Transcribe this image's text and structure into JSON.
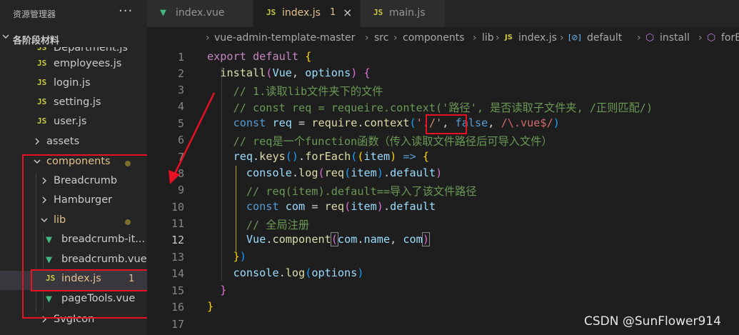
{
  "sidebar": {
    "title": "资源管理器",
    "more_icon": "ellipsis-icon",
    "section_label": "各阶段材料",
    "items": [
      {
        "label": "Department.js",
        "type": "js"
      },
      {
        "label": "employees.js",
        "type": "js"
      },
      {
        "label": "login.js",
        "type": "js"
      },
      {
        "label": "setting.js",
        "type": "js"
      },
      {
        "label": "user.js",
        "type": "js"
      },
      {
        "label": "assets",
        "type": "folder-collapsed"
      },
      {
        "label": "components",
        "type": "folder-expanded"
      },
      {
        "label": "Breadcrumb",
        "type": "folder-collapsed"
      },
      {
        "label": "Hamburger",
        "type": "folder-collapsed"
      },
      {
        "label": "lib",
        "type": "folder-expanded"
      },
      {
        "label": "breadcrumb-it...",
        "type": "vue"
      },
      {
        "label": "breadcrumb.vue",
        "type": "vue"
      },
      {
        "label": "index.js",
        "type": "js",
        "badge": "1"
      },
      {
        "label": "pageTools.vue",
        "type": "vue"
      },
      {
        "label": "SvgIcon",
        "type": "folder-collapsed"
      }
    ]
  },
  "tabs": [
    {
      "label": "index.vue",
      "type": "vue"
    },
    {
      "label": "index.js",
      "type": "js",
      "badge": "1",
      "active": true
    },
    {
      "label": "main.js",
      "type": "js"
    }
  ],
  "file_icon_text": "JS",
  "breadcrumb": [
    "vue-admin-template-master",
    "src",
    "components",
    "lib",
    "index.js",
    "default",
    "install",
    "forEach"
  ],
  "code": {
    "line_numbers": [
      "1",
      "2",
      "3",
      "4",
      "5",
      "6",
      "7",
      "8",
      "9",
      "10",
      "11",
      "12",
      "13",
      "14",
      "15",
      "16",
      "17"
    ],
    "current_line": "12",
    "comment1": "// 1.读取lib文件夹下的文件",
    "comment2": "// const req = requeire.context('路径', 是否读取子文件夹, /正则匹配/)",
    "comment3": "// req是一个function函数（传入读取文件路径后可导入文件）",
    "comment4": "// req(item).default==导入了该文件路径",
    "comment5": "// 全局注册"
  },
  "watermark": "CSDN @SunFlower914",
  "colors": {
    "annotation": "#e81123",
    "js_icon": "#cbcb41",
    "vue_icon": "#41b883",
    "modified": "#e2c08d"
  }
}
